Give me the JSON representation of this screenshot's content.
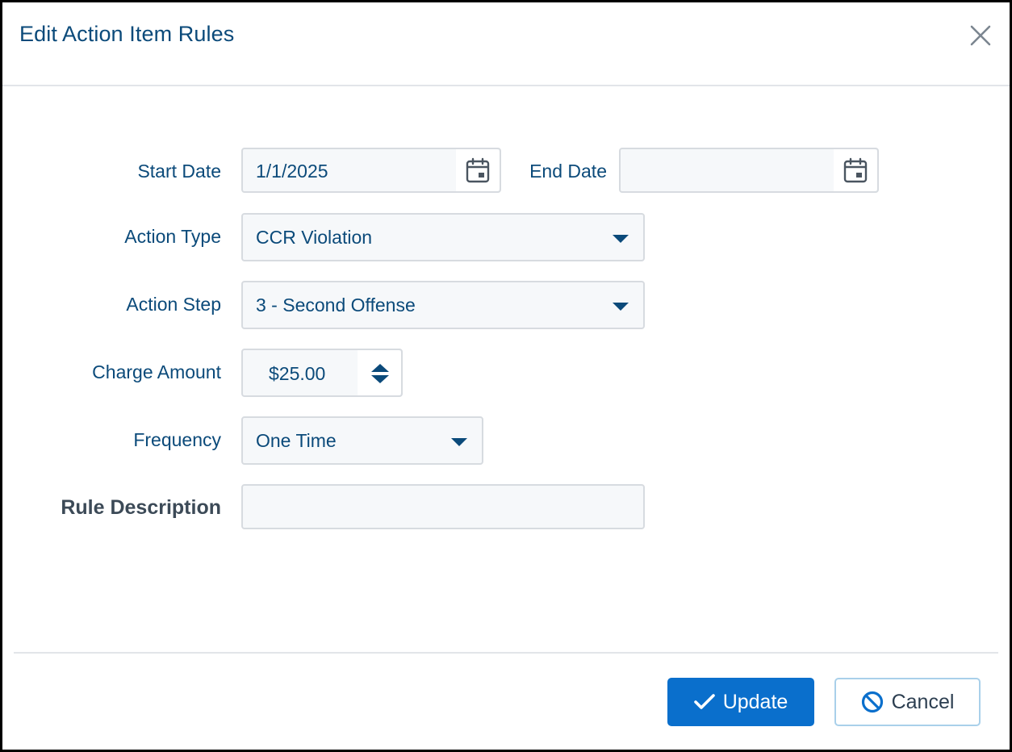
{
  "dialog": {
    "title": "Edit Action Item Rules"
  },
  "form": {
    "start_date": {
      "label": "Start Date",
      "value": "1/1/2025"
    },
    "end_date": {
      "label": "End Date",
      "value": ""
    },
    "action_type": {
      "label": "Action Type",
      "value": "CCR Violation"
    },
    "action_step": {
      "label": "Action Step",
      "value": "3 - Second Offense"
    },
    "charge_amount": {
      "label": "Charge Amount",
      "value": "$25.00"
    },
    "frequency": {
      "label": "Frequency",
      "value": "One Time"
    },
    "rule_description": {
      "label": "Rule Description",
      "value": ""
    }
  },
  "footer": {
    "update_label": "Update",
    "cancel_label": "Cancel"
  },
  "colors": {
    "accent": "#0a6fcc",
    "text_primary": "#0b4a7a",
    "cancel_border": "#a9d0ea"
  }
}
